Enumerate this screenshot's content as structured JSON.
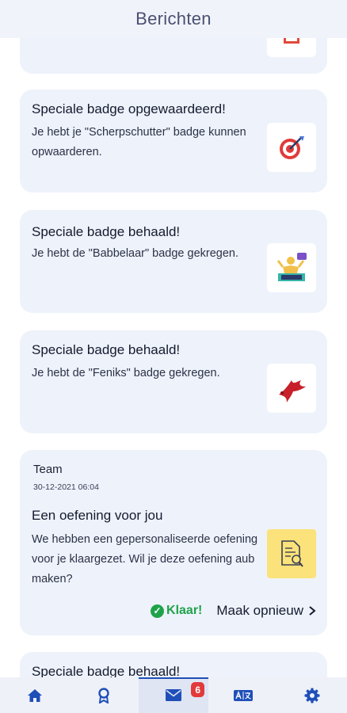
{
  "header": {
    "title": "Berichten"
  },
  "cards": [
    {
      "title": "Speciale badge opgewaardeerd!",
      "body": "Je hebt je \"Scherpschutter\" badge kunnen opwaarderen.",
      "badge_icon": "target-badge-icon"
    },
    {
      "title": "Speciale badge behaald!",
      "body": "Je hebt de \"Babbelaar\" badge gekregen.",
      "badge_icon": "speaker-badge-icon"
    },
    {
      "title": "Speciale badge behaald!",
      "body": "Je hebt de \"Feniks\" badge gekregen.",
      "badge_icon": "phoenix-badge-icon"
    }
  ],
  "exercise": {
    "sender": "Team",
    "date": "30-12-2021 06:04",
    "title": "Een oefening voor jou",
    "body": "We hebben een gepersonaliseerde oefening voor je klaargezet. Wil je deze oefening aub maken?",
    "done_label": "Klaar!",
    "redo_label": "Maak opnieuw"
  },
  "partial_card": {
    "title": "Speciale badge behaald!"
  },
  "bottom_nav": {
    "items": [
      {
        "icon": "home-icon"
      },
      {
        "icon": "badge-icon"
      },
      {
        "icon": "mail-icon",
        "badge": "6"
      },
      {
        "icon": "translate-icon"
      },
      {
        "icon": "settings-icon"
      }
    ]
  },
  "colors": {
    "card_bg": "#eef2fb",
    "success": "#1fa34a",
    "notification": "#e23a3a",
    "accent": "#1f4fb8"
  }
}
